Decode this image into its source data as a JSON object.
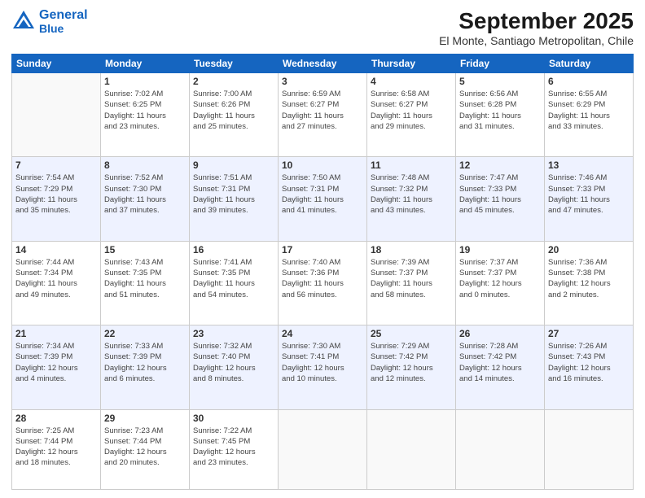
{
  "header": {
    "logo_line1": "General",
    "logo_line2": "Blue",
    "month": "September 2025",
    "location": "El Monte, Santiago Metropolitan, Chile"
  },
  "days_of_week": [
    "Sunday",
    "Monday",
    "Tuesday",
    "Wednesday",
    "Thursday",
    "Friday",
    "Saturday"
  ],
  "weeks": [
    [
      {
        "day": "",
        "info": ""
      },
      {
        "day": "1",
        "info": "Sunrise: 7:02 AM\nSunset: 6:25 PM\nDaylight: 11 hours\nand 23 minutes."
      },
      {
        "day": "2",
        "info": "Sunrise: 7:00 AM\nSunset: 6:26 PM\nDaylight: 11 hours\nand 25 minutes."
      },
      {
        "day": "3",
        "info": "Sunrise: 6:59 AM\nSunset: 6:27 PM\nDaylight: 11 hours\nand 27 minutes."
      },
      {
        "day": "4",
        "info": "Sunrise: 6:58 AM\nSunset: 6:27 PM\nDaylight: 11 hours\nand 29 minutes."
      },
      {
        "day": "5",
        "info": "Sunrise: 6:56 AM\nSunset: 6:28 PM\nDaylight: 11 hours\nand 31 minutes."
      },
      {
        "day": "6",
        "info": "Sunrise: 6:55 AM\nSunset: 6:29 PM\nDaylight: 11 hours\nand 33 minutes."
      }
    ],
    [
      {
        "day": "7",
        "info": "Sunrise: 7:54 AM\nSunset: 7:29 PM\nDaylight: 11 hours\nand 35 minutes."
      },
      {
        "day": "8",
        "info": "Sunrise: 7:52 AM\nSunset: 7:30 PM\nDaylight: 11 hours\nand 37 minutes."
      },
      {
        "day": "9",
        "info": "Sunrise: 7:51 AM\nSunset: 7:31 PM\nDaylight: 11 hours\nand 39 minutes."
      },
      {
        "day": "10",
        "info": "Sunrise: 7:50 AM\nSunset: 7:31 PM\nDaylight: 11 hours\nand 41 minutes."
      },
      {
        "day": "11",
        "info": "Sunrise: 7:48 AM\nSunset: 7:32 PM\nDaylight: 11 hours\nand 43 minutes."
      },
      {
        "day": "12",
        "info": "Sunrise: 7:47 AM\nSunset: 7:33 PM\nDaylight: 11 hours\nand 45 minutes."
      },
      {
        "day": "13",
        "info": "Sunrise: 7:46 AM\nSunset: 7:33 PM\nDaylight: 11 hours\nand 47 minutes."
      }
    ],
    [
      {
        "day": "14",
        "info": "Sunrise: 7:44 AM\nSunset: 7:34 PM\nDaylight: 11 hours\nand 49 minutes."
      },
      {
        "day": "15",
        "info": "Sunrise: 7:43 AM\nSunset: 7:35 PM\nDaylight: 11 hours\nand 51 minutes."
      },
      {
        "day": "16",
        "info": "Sunrise: 7:41 AM\nSunset: 7:35 PM\nDaylight: 11 hours\nand 54 minutes."
      },
      {
        "day": "17",
        "info": "Sunrise: 7:40 AM\nSunset: 7:36 PM\nDaylight: 11 hours\nand 56 minutes."
      },
      {
        "day": "18",
        "info": "Sunrise: 7:39 AM\nSunset: 7:37 PM\nDaylight: 11 hours\nand 58 minutes."
      },
      {
        "day": "19",
        "info": "Sunrise: 7:37 AM\nSunset: 7:37 PM\nDaylight: 12 hours\nand 0 minutes."
      },
      {
        "day": "20",
        "info": "Sunrise: 7:36 AM\nSunset: 7:38 PM\nDaylight: 12 hours\nand 2 minutes."
      }
    ],
    [
      {
        "day": "21",
        "info": "Sunrise: 7:34 AM\nSunset: 7:39 PM\nDaylight: 12 hours\nand 4 minutes."
      },
      {
        "day": "22",
        "info": "Sunrise: 7:33 AM\nSunset: 7:39 PM\nDaylight: 12 hours\nand 6 minutes."
      },
      {
        "day": "23",
        "info": "Sunrise: 7:32 AM\nSunset: 7:40 PM\nDaylight: 12 hours\nand 8 minutes."
      },
      {
        "day": "24",
        "info": "Sunrise: 7:30 AM\nSunset: 7:41 PM\nDaylight: 12 hours\nand 10 minutes."
      },
      {
        "day": "25",
        "info": "Sunrise: 7:29 AM\nSunset: 7:42 PM\nDaylight: 12 hours\nand 12 minutes."
      },
      {
        "day": "26",
        "info": "Sunrise: 7:28 AM\nSunset: 7:42 PM\nDaylight: 12 hours\nand 14 minutes."
      },
      {
        "day": "27",
        "info": "Sunrise: 7:26 AM\nSunset: 7:43 PM\nDaylight: 12 hours\nand 16 minutes."
      }
    ],
    [
      {
        "day": "28",
        "info": "Sunrise: 7:25 AM\nSunset: 7:44 PM\nDaylight: 12 hours\nand 18 minutes."
      },
      {
        "day": "29",
        "info": "Sunrise: 7:23 AM\nSunset: 7:44 PM\nDaylight: 12 hours\nand 20 minutes."
      },
      {
        "day": "30",
        "info": "Sunrise: 7:22 AM\nSunset: 7:45 PM\nDaylight: 12 hours\nand 23 minutes."
      },
      {
        "day": "",
        "info": ""
      },
      {
        "day": "",
        "info": ""
      },
      {
        "day": "",
        "info": ""
      },
      {
        "day": "",
        "info": ""
      }
    ]
  ]
}
